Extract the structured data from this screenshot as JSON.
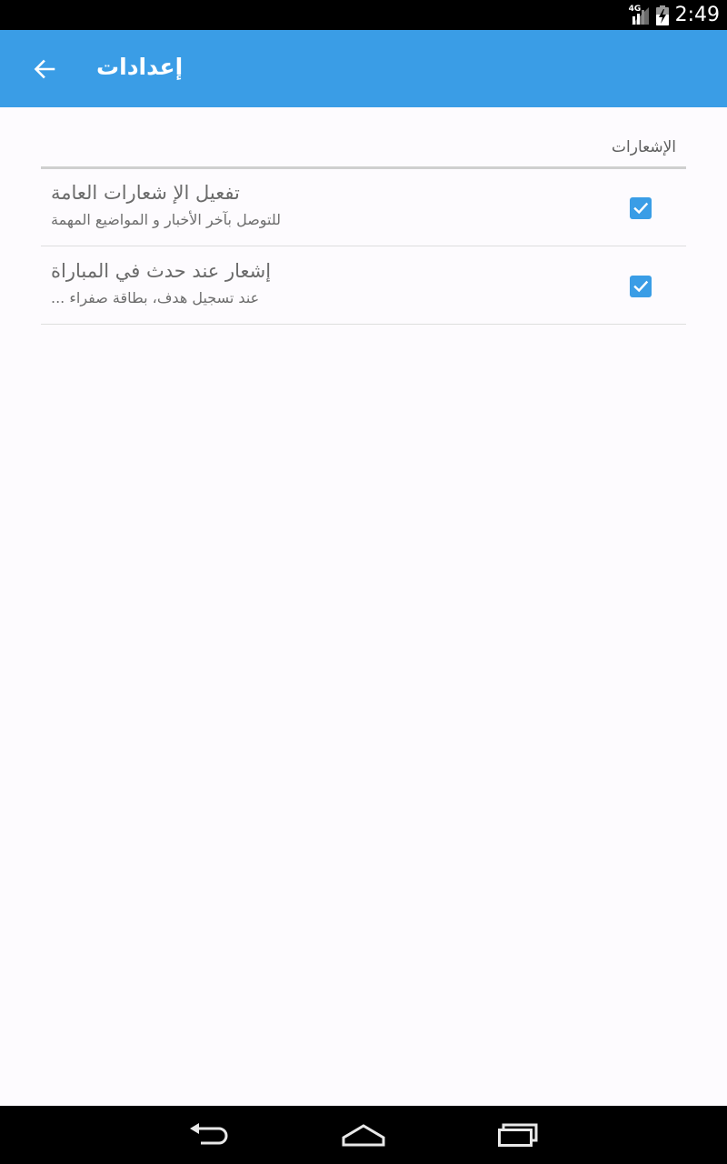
{
  "status_bar": {
    "network_label": "4G",
    "time": "2:49",
    "icons": [
      "signal-icon",
      "battery-icon"
    ]
  },
  "app_bar": {
    "title": "إعدادات",
    "back_icon": "arrow-back-icon",
    "background_color": "#3a9de6"
  },
  "settings": {
    "section_title": "الإشعارات",
    "items": [
      {
        "title": "تفعيل الإ شعارات العامة",
        "summary": "للتوصل بآخر الأخبار و المواضيع المهمة",
        "checked": true
      },
      {
        "title": "إشعار عند حدث في المباراة",
        "summary": "عند تسجيل هدف، بطاقة صفراء ...",
        "checked": true
      }
    ]
  },
  "nav_bar": {
    "buttons": [
      "back-nav-icon",
      "home-nav-icon",
      "recents-nav-icon"
    ]
  },
  "colors": {
    "accent": "#3a9de6",
    "background": "#fdfbfe",
    "status_bar": "#000000"
  }
}
